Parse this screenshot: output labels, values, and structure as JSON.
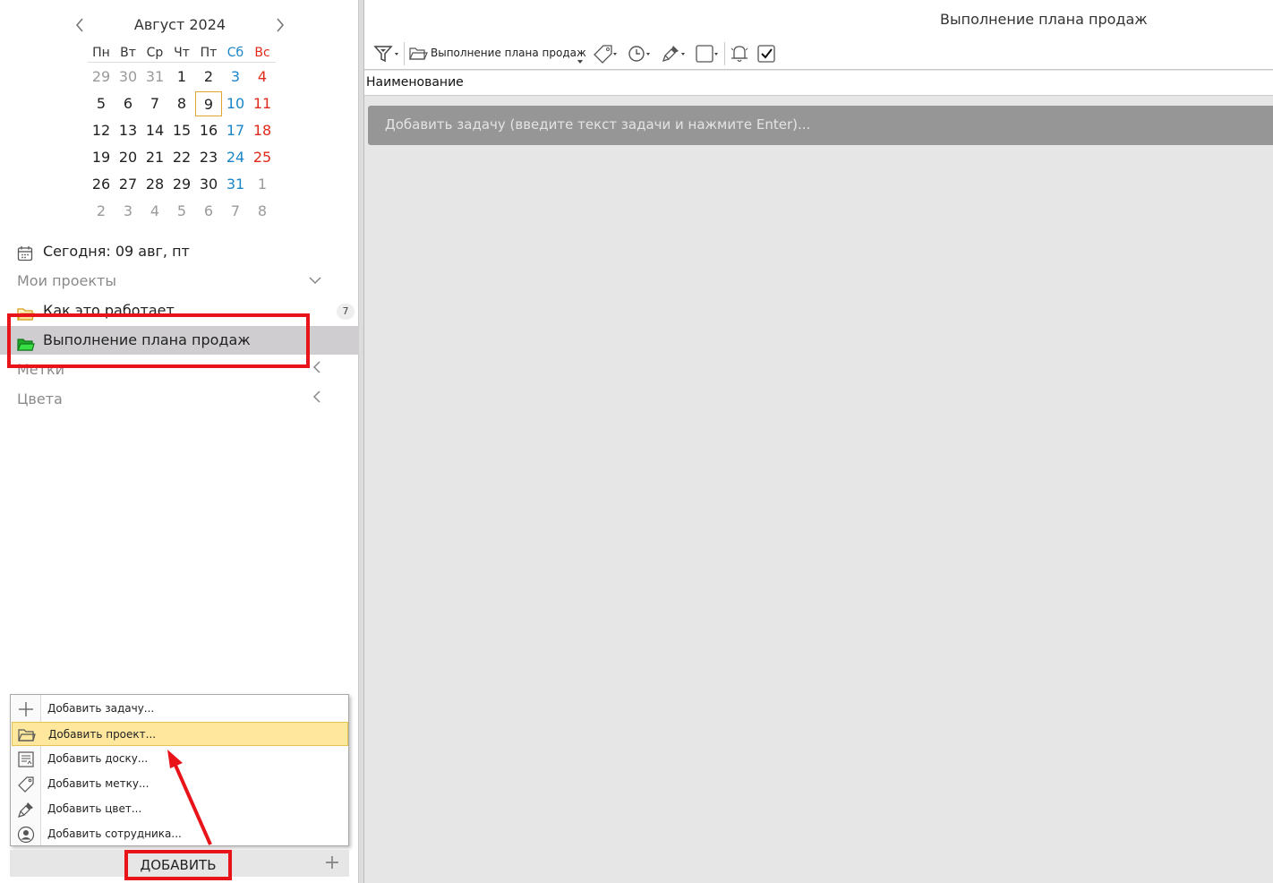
{
  "calendar": {
    "title": "Август 2024",
    "prev_icon": "chevron-left-icon",
    "next_icon": "chevron-right-icon",
    "weekdays": [
      "Пн",
      "Вт",
      "Ср",
      "Чт",
      "Пт",
      "Сб",
      "Вс"
    ],
    "weeks": [
      [
        "29",
        "30",
        "31",
        "1",
        "2",
        "3",
        "4"
      ],
      [
        "5",
        "6",
        "7",
        "8",
        "9",
        "10",
        "11"
      ],
      [
        "12",
        "13",
        "14",
        "15",
        "16",
        "17",
        "18"
      ],
      [
        "19",
        "20",
        "21",
        "22",
        "23",
        "24",
        "25"
      ],
      [
        "26",
        "27",
        "28",
        "29",
        "30",
        "31",
        "1"
      ],
      [
        "2",
        "3",
        "4",
        "5",
        "6",
        "7",
        "8"
      ]
    ],
    "today": "9"
  },
  "sidebar": {
    "today_label": "Сегодня: 09 авг, пт",
    "my_projects": "Мои проекты",
    "projects": [
      {
        "label": "Как это работает",
        "badge": "7"
      },
      {
        "label": "Выполнение плана продаж"
      }
    ],
    "tags": "Метки",
    "colors": "Цвета"
  },
  "menu": {
    "items": [
      {
        "label": "Добавить задачу...",
        "icon": "plus-icon"
      },
      {
        "label": "Добавить проект...",
        "icon": "folder-icon"
      },
      {
        "label": "Добавить доску...",
        "icon": "board-icon"
      },
      {
        "label": "Добавить метку...",
        "icon": "tag-icon"
      },
      {
        "label": "Добавить цвет...",
        "icon": "brush-icon"
      },
      {
        "label": "Добавить сотрудника...",
        "icon": "user-icon"
      }
    ]
  },
  "add_button": {
    "label": "ДОБАВИТЬ"
  },
  "main": {
    "title": "Выполнение плана продаж",
    "toolbar_project": "Выполнение плана продаж",
    "column_header": "Наименование",
    "add_task_placeholder": "Добавить задачу (введите текст задачи и нажмите Enter)..."
  },
  "colors": {
    "accent_red": "#e8141a",
    "highlight": "#ffe79e",
    "selected_row": "#cfcdd0",
    "weekend_sat": "#1a86c8",
    "weekend_sun": "#e0291a"
  }
}
